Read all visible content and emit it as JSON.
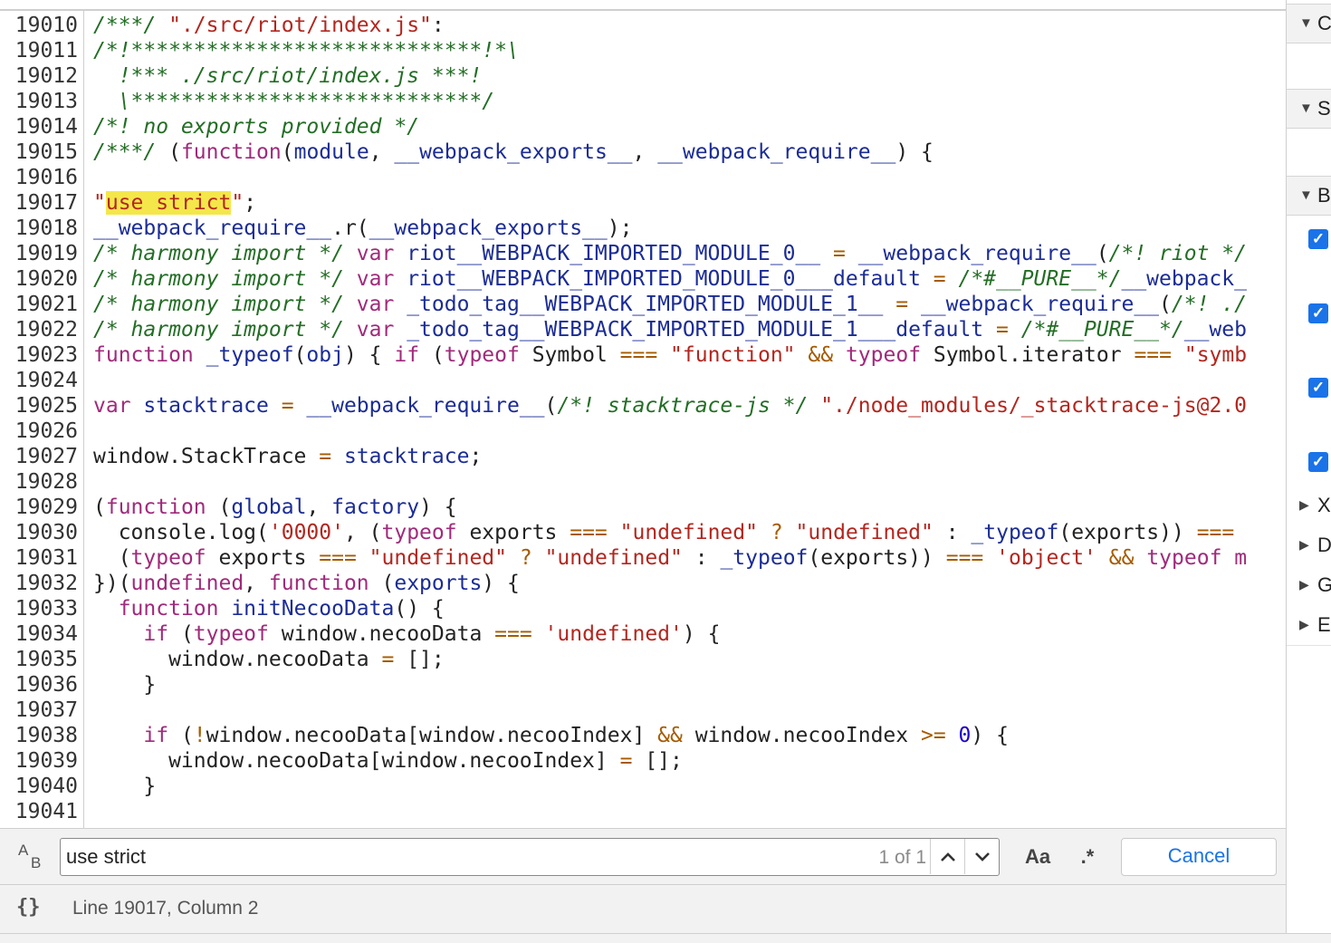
{
  "editor": {
    "lines": [
      {
        "n": "19010",
        "tokens": [
          [
            "c",
            "/***/ "
          ],
          [
            "s",
            "\"./src/riot/index.js\""
          ],
          [
            "p",
            ":"
          ]
        ]
      },
      {
        "n": "19011",
        "tokens": [
          [
            "c",
            "/*!****************************!*\\"
          ]
        ]
      },
      {
        "n": "19012",
        "tokens": [
          [
            "c",
            "  !*** ./src/riot/index.js ***!"
          ]
        ]
      },
      {
        "n": "19013",
        "tokens": [
          [
            "c",
            "  \\****************************/"
          ]
        ]
      },
      {
        "n": "19014",
        "tokens": [
          [
            "c",
            "/*! no exports provided */"
          ]
        ]
      },
      {
        "n": "19015",
        "tokens": [
          [
            "c",
            "/***/ "
          ],
          [
            "p",
            "("
          ],
          [
            "k",
            "function"
          ],
          [
            "p",
            "("
          ],
          [
            "v",
            "module"
          ],
          [
            "p",
            ", "
          ],
          [
            "v",
            "__webpack_exports__"
          ],
          [
            "p",
            ", "
          ],
          [
            "v",
            "__webpack_require__"
          ],
          [
            "p",
            ") {"
          ]
        ]
      },
      {
        "n": "19016",
        "tokens": []
      },
      {
        "n": "19017",
        "tokens": [
          [
            "s",
            "\""
          ],
          [
            "h",
            "use strict"
          ],
          [
            "s",
            "\""
          ],
          [
            "p",
            ";"
          ]
        ]
      },
      {
        "n": "19018",
        "tokens": [
          [
            "v",
            "__webpack_require__"
          ],
          [
            "p",
            ".r("
          ],
          [
            "v",
            "__webpack_exports__"
          ],
          [
            "p",
            ");"
          ]
        ]
      },
      {
        "n": "19019",
        "tokens": [
          [
            "c",
            "/* harmony import */ "
          ],
          [
            "k",
            "var "
          ],
          [
            "v",
            "riot__WEBPACK_IMPORTED_MODULE_0__"
          ],
          [
            "o",
            " = "
          ],
          [
            "v",
            "__webpack_require__"
          ],
          [
            "p",
            "("
          ],
          [
            "c",
            "/*! riot */"
          ]
        ]
      },
      {
        "n": "19020",
        "tokens": [
          [
            "c",
            "/* harmony import */ "
          ],
          [
            "k",
            "var "
          ],
          [
            "v",
            "riot__WEBPACK_IMPORTED_MODULE_0___default"
          ],
          [
            "o",
            " = "
          ],
          [
            "c",
            "/*#__PURE__*/"
          ],
          [
            "v",
            "__webpack_"
          ]
        ]
      },
      {
        "n": "19021",
        "tokens": [
          [
            "c",
            "/* harmony import */ "
          ],
          [
            "k",
            "var "
          ],
          [
            "v",
            "_todo_tag__WEBPACK_IMPORTED_MODULE_1__"
          ],
          [
            "o",
            " = "
          ],
          [
            "v",
            "__webpack_require__"
          ],
          [
            "p",
            "("
          ],
          [
            "c",
            "/*! ./"
          ]
        ]
      },
      {
        "n": "19022",
        "tokens": [
          [
            "c",
            "/* harmony import */ "
          ],
          [
            "k",
            "var "
          ],
          [
            "v",
            "_todo_tag__WEBPACK_IMPORTED_MODULE_1___default"
          ],
          [
            "o",
            " = "
          ],
          [
            "c",
            "/*#__PURE__*/"
          ],
          [
            "v",
            "__web"
          ]
        ]
      },
      {
        "n": "19023",
        "tokens": [
          [
            "k",
            "function "
          ],
          [
            "v",
            "_typeof"
          ],
          [
            "p",
            "("
          ],
          [
            "v",
            "obj"
          ],
          [
            "p",
            ") { "
          ],
          [
            "k",
            "if "
          ],
          [
            "p",
            "("
          ],
          [
            "k",
            "typeof "
          ],
          [
            "p",
            "Symbol "
          ],
          [
            "o",
            "==="
          ],
          [
            "p",
            " "
          ],
          [
            "s",
            "\"function\""
          ],
          [
            "p",
            " "
          ],
          [
            "o",
            "&&"
          ],
          [
            "p",
            " "
          ],
          [
            "k",
            "typeof "
          ],
          [
            "p",
            "Symbol.iterator "
          ],
          [
            "o",
            "==="
          ],
          [
            "p",
            " "
          ],
          [
            "s",
            "\"symb"
          ]
        ]
      },
      {
        "n": "19024",
        "tokens": []
      },
      {
        "n": "19025",
        "tokens": [
          [
            "k",
            "var "
          ],
          [
            "v",
            "stacktrace"
          ],
          [
            "o",
            " = "
          ],
          [
            "v",
            "__webpack_require__"
          ],
          [
            "p",
            "("
          ],
          [
            "c",
            "/*! stacktrace-js */"
          ],
          [
            "p",
            " "
          ],
          [
            "s",
            "\"./node_modules/_stacktrace-js@2.0"
          ]
        ]
      },
      {
        "n": "19026",
        "tokens": []
      },
      {
        "n": "19027",
        "tokens": [
          [
            "p",
            "window.StackTrace "
          ],
          [
            "o",
            "="
          ],
          [
            "p",
            " "
          ],
          [
            "v",
            "stacktrace"
          ],
          [
            "p",
            ";"
          ]
        ]
      },
      {
        "n": "19028",
        "tokens": []
      },
      {
        "n": "19029",
        "tokens": [
          [
            "p",
            "("
          ],
          [
            "k",
            "function "
          ],
          [
            "p",
            "("
          ],
          [
            "v",
            "global"
          ],
          [
            "p",
            ", "
          ],
          [
            "v",
            "factory"
          ],
          [
            "p",
            ") {"
          ]
        ]
      },
      {
        "n": "19030",
        "tokens": [
          [
            "p",
            "  console.log("
          ],
          [
            "s",
            "'0000'"
          ],
          [
            "p",
            ", ("
          ],
          [
            "k",
            "typeof "
          ],
          [
            "p",
            "exports "
          ],
          [
            "o",
            "==="
          ],
          [
            "p",
            " "
          ],
          [
            "s",
            "\"undefined\""
          ],
          [
            "p",
            " "
          ],
          [
            "o",
            "?"
          ],
          [
            "p",
            " "
          ],
          [
            "s",
            "\"undefined\""
          ],
          [
            "p",
            " : "
          ],
          [
            "v",
            "_typeof"
          ],
          [
            "p",
            "(exports)) "
          ],
          [
            "o",
            "==="
          ]
        ]
      },
      {
        "n": "19031",
        "tokens": [
          [
            "p",
            "  ("
          ],
          [
            "k",
            "typeof "
          ],
          [
            "p",
            "exports "
          ],
          [
            "o",
            "==="
          ],
          [
            "p",
            " "
          ],
          [
            "s",
            "\"undefined\""
          ],
          [
            "p",
            " "
          ],
          [
            "o",
            "?"
          ],
          [
            "p",
            " "
          ],
          [
            "s",
            "\"undefined\""
          ],
          [
            "p",
            " : "
          ],
          [
            "v",
            "_typeof"
          ],
          [
            "p",
            "(exports)) "
          ],
          [
            "o",
            "==="
          ],
          [
            "p",
            " "
          ],
          [
            "s",
            "'object'"
          ],
          [
            "p",
            " "
          ],
          [
            "o",
            "&&"
          ],
          [
            "p",
            " "
          ],
          [
            "k",
            "typeof m"
          ]
        ]
      },
      {
        "n": "19032",
        "tokens": [
          [
            "p",
            "})("
          ],
          [
            "k",
            "undefined"
          ],
          [
            "p",
            ", "
          ],
          [
            "k",
            "function "
          ],
          [
            "p",
            "("
          ],
          [
            "v",
            "exports"
          ],
          [
            "p",
            ") {"
          ]
        ]
      },
      {
        "n": "19033",
        "tokens": [
          [
            "p",
            "  "
          ],
          [
            "k",
            "function "
          ],
          [
            "v",
            "initNecooData"
          ],
          [
            "p",
            "() {"
          ]
        ]
      },
      {
        "n": "19034",
        "tokens": [
          [
            "p",
            "    "
          ],
          [
            "k",
            "if "
          ],
          [
            "p",
            "("
          ],
          [
            "k",
            "typeof "
          ],
          [
            "p",
            "window.necooData "
          ],
          [
            "o",
            "==="
          ],
          [
            "p",
            " "
          ],
          [
            "s",
            "'undefined'"
          ],
          [
            "p",
            ") {"
          ]
        ]
      },
      {
        "n": "19035",
        "tokens": [
          [
            "p",
            "      window.necooData "
          ],
          [
            "o",
            "="
          ],
          [
            "p",
            " [];"
          ]
        ]
      },
      {
        "n": "19036",
        "tokens": [
          [
            "p",
            "    }"
          ]
        ]
      },
      {
        "n": "19037",
        "tokens": []
      },
      {
        "n": "19038",
        "tokens": [
          [
            "p",
            "    "
          ],
          [
            "k",
            "if "
          ],
          [
            "p",
            "("
          ],
          [
            "o",
            "!"
          ],
          [
            "p",
            "window.necooData[window.necooIndex] "
          ],
          [
            "o",
            "&&"
          ],
          [
            "p",
            " window.necooIndex "
          ],
          [
            "o",
            ">="
          ],
          [
            "p",
            " "
          ],
          [
            "n",
            "0"
          ],
          [
            "p",
            ") {"
          ]
        ]
      },
      {
        "n": "19039",
        "tokens": [
          [
            "p",
            "      window.necooData[window.necooIndex] "
          ],
          [
            "o",
            "="
          ],
          [
            "p",
            " [];"
          ]
        ]
      },
      {
        "n": "19040",
        "tokens": [
          [
            "p",
            "    }"
          ]
        ]
      },
      {
        "n": "19041",
        "tokens": []
      }
    ]
  },
  "search": {
    "replace_toggle_a": "A",
    "replace_toggle_b": "B",
    "value": "use strict",
    "match_count": "1 of 1",
    "case_label": "Aa",
    "regex_label": ".*",
    "cancel_label": "Cancel"
  },
  "status": {
    "pretty_print": "{}",
    "cursor": "Line 19017, Column 2"
  },
  "sidebar": {
    "sections": [
      {
        "label": "C",
        "expanded": true
      },
      {
        "label": "S",
        "expanded": true
      },
      {
        "label": "B",
        "expanded": true
      }
    ],
    "checks": [
      "✓",
      "✓",
      "✓",
      "✓"
    ],
    "collapsed": [
      {
        "label": "X"
      },
      {
        "label": "D"
      },
      {
        "label": "G"
      },
      {
        "label": "E"
      }
    ]
  },
  "colors": {
    "keyword": "#a02a7b",
    "string": "#b3261e",
    "comment": "#236e25",
    "variable": "#1b2c96",
    "operator": "#a65b00",
    "highlight": "#f4e74a",
    "accent": "#1a73e8"
  }
}
